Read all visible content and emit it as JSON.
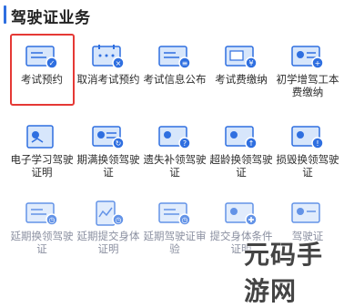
{
  "header": {
    "title": "驾驶证业务"
  },
  "services": [
    {
      "label": "考试预约",
      "icon": "exam-booking-icon",
      "faded": false
    },
    {
      "label": "取消考试预约",
      "icon": "cancel-exam-booking-icon",
      "faded": false
    },
    {
      "label": "考试信息公布",
      "icon": "exam-info-icon",
      "faded": false
    },
    {
      "label": "考试费缴纳",
      "icon": "exam-fee-icon",
      "faded": false
    },
    {
      "label": "初学增驾工本费缴纳",
      "icon": "cost-fee-icon",
      "faded": false
    },
    {
      "label": "电子学习驾驶证明",
      "icon": "e-learning-icon",
      "faded": false
    },
    {
      "label": "期满换领驾驶证",
      "icon": "renew-license-icon",
      "faded": false
    },
    {
      "label": "遗失补领驾驶证",
      "icon": "lost-replace-icon",
      "faded": false
    },
    {
      "label": "超龄换领驾驶证",
      "icon": "overage-renew-icon",
      "faded": false
    },
    {
      "label": "损毁换领驾驶证",
      "icon": "damaged-renew-icon",
      "faded": false
    },
    {
      "label": "延期换领驾驶证",
      "icon": "delay-renew-icon",
      "faded": true
    },
    {
      "label": "延期提交身体证明",
      "icon": "delay-health-icon",
      "faded": true
    },
    {
      "label": "延期驾驶证审验",
      "icon": "delay-review-icon",
      "faded": true
    },
    {
      "label": "提交身体条件证明",
      "icon": "submit-health-icon",
      "faded": true
    },
    {
      "label": "驾驶证",
      "icon": "license-icon",
      "faded": true
    }
  ],
  "colors": {
    "accent": "#2f6fe0",
    "highlight": "#e53935",
    "icon_light": "#d7e6fb"
  },
  "watermark": {
    "text": "元码手游网"
  }
}
